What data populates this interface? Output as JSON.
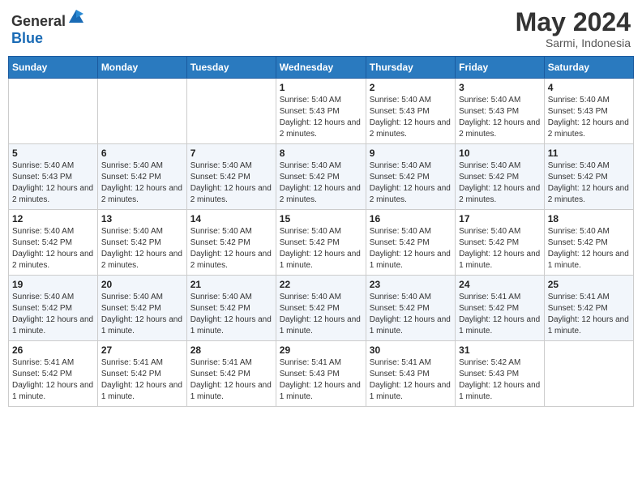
{
  "header": {
    "logo_general": "General",
    "logo_blue": "Blue",
    "month_title": "May 2024",
    "location": "Sarmi, Indonesia"
  },
  "weekdays": [
    "Sunday",
    "Monday",
    "Tuesday",
    "Wednesday",
    "Thursday",
    "Friday",
    "Saturday"
  ],
  "weeks": [
    [
      {
        "day": "",
        "sunrise": "",
        "sunset": "",
        "daylight": ""
      },
      {
        "day": "",
        "sunrise": "",
        "sunset": "",
        "daylight": ""
      },
      {
        "day": "",
        "sunrise": "",
        "sunset": "",
        "daylight": ""
      },
      {
        "day": "1",
        "sunrise": "Sunrise: 5:40 AM",
        "sunset": "Sunset: 5:43 PM",
        "daylight": "Daylight: 12 hours and 2 minutes."
      },
      {
        "day": "2",
        "sunrise": "Sunrise: 5:40 AM",
        "sunset": "Sunset: 5:43 PM",
        "daylight": "Daylight: 12 hours and 2 minutes."
      },
      {
        "day": "3",
        "sunrise": "Sunrise: 5:40 AM",
        "sunset": "Sunset: 5:43 PM",
        "daylight": "Daylight: 12 hours and 2 minutes."
      },
      {
        "day": "4",
        "sunrise": "Sunrise: 5:40 AM",
        "sunset": "Sunset: 5:43 PM",
        "daylight": "Daylight: 12 hours and 2 minutes."
      }
    ],
    [
      {
        "day": "5",
        "sunrise": "Sunrise: 5:40 AM",
        "sunset": "Sunset: 5:43 PM",
        "daylight": "Daylight: 12 hours and 2 minutes."
      },
      {
        "day": "6",
        "sunrise": "Sunrise: 5:40 AM",
        "sunset": "Sunset: 5:42 PM",
        "daylight": "Daylight: 12 hours and 2 minutes."
      },
      {
        "day": "7",
        "sunrise": "Sunrise: 5:40 AM",
        "sunset": "Sunset: 5:42 PM",
        "daylight": "Daylight: 12 hours and 2 minutes."
      },
      {
        "day": "8",
        "sunrise": "Sunrise: 5:40 AM",
        "sunset": "Sunset: 5:42 PM",
        "daylight": "Daylight: 12 hours and 2 minutes."
      },
      {
        "day": "9",
        "sunrise": "Sunrise: 5:40 AM",
        "sunset": "Sunset: 5:42 PM",
        "daylight": "Daylight: 12 hours and 2 minutes."
      },
      {
        "day": "10",
        "sunrise": "Sunrise: 5:40 AM",
        "sunset": "Sunset: 5:42 PM",
        "daylight": "Daylight: 12 hours and 2 minutes."
      },
      {
        "day": "11",
        "sunrise": "Sunrise: 5:40 AM",
        "sunset": "Sunset: 5:42 PM",
        "daylight": "Daylight: 12 hours and 2 minutes."
      }
    ],
    [
      {
        "day": "12",
        "sunrise": "Sunrise: 5:40 AM",
        "sunset": "Sunset: 5:42 PM",
        "daylight": "Daylight: 12 hours and 2 minutes."
      },
      {
        "day": "13",
        "sunrise": "Sunrise: 5:40 AM",
        "sunset": "Sunset: 5:42 PM",
        "daylight": "Daylight: 12 hours and 2 minutes."
      },
      {
        "day": "14",
        "sunrise": "Sunrise: 5:40 AM",
        "sunset": "Sunset: 5:42 PM",
        "daylight": "Daylight: 12 hours and 2 minutes."
      },
      {
        "day": "15",
        "sunrise": "Sunrise: 5:40 AM",
        "sunset": "Sunset: 5:42 PM",
        "daylight": "Daylight: 12 hours and 1 minute."
      },
      {
        "day": "16",
        "sunrise": "Sunrise: 5:40 AM",
        "sunset": "Sunset: 5:42 PM",
        "daylight": "Daylight: 12 hours and 1 minute."
      },
      {
        "day": "17",
        "sunrise": "Sunrise: 5:40 AM",
        "sunset": "Sunset: 5:42 PM",
        "daylight": "Daylight: 12 hours and 1 minute."
      },
      {
        "day": "18",
        "sunrise": "Sunrise: 5:40 AM",
        "sunset": "Sunset: 5:42 PM",
        "daylight": "Daylight: 12 hours and 1 minute."
      }
    ],
    [
      {
        "day": "19",
        "sunrise": "Sunrise: 5:40 AM",
        "sunset": "Sunset: 5:42 PM",
        "daylight": "Daylight: 12 hours and 1 minute."
      },
      {
        "day": "20",
        "sunrise": "Sunrise: 5:40 AM",
        "sunset": "Sunset: 5:42 PM",
        "daylight": "Daylight: 12 hours and 1 minute."
      },
      {
        "day": "21",
        "sunrise": "Sunrise: 5:40 AM",
        "sunset": "Sunset: 5:42 PM",
        "daylight": "Daylight: 12 hours and 1 minute."
      },
      {
        "day": "22",
        "sunrise": "Sunrise: 5:40 AM",
        "sunset": "Sunset: 5:42 PM",
        "daylight": "Daylight: 12 hours and 1 minute."
      },
      {
        "day": "23",
        "sunrise": "Sunrise: 5:40 AM",
        "sunset": "Sunset: 5:42 PM",
        "daylight": "Daylight: 12 hours and 1 minute."
      },
      {
        "day": "24",
        "sunrise": "Sunrise: 5:41 AM",
        "sunset": "Sunset: 5:42 PM",
        "daylight": "Daylight: 12 hours and 1 minute."
      },
      {
        "day": "25",
        "sunrise": "Sunrise: 5:41 AM",
        "sunset": "Sunset: 5:42 PM",
        "daylight": "Daylight: 12 hours and 1 minute."
      }
    ],
    [
      {
        "day": "26",
        "sunrise": "Sunrise: 5:41 AM",
        "sunset": "Sunset: 5:42 PM",
        "daylight": "Daylight: 12 hours and 1 minute."
      },
      {
        "day": "27",
        "sunrise": "Sunrise: 5:41 AM",
        "sunset": "Sunset: 5:42 PM",
        "daylight": "Daylight: 12 hours and 1 minute."
      },
      {
        "day": "28",
        "sunrise": "Sunrise: 5:41 AM",
        "sunset": "Sunset: 5:42 PM",
        "daylight": "Daylight: 12 hours and 1 minute."
      },
      {
        "day": "29",
        "sunrise": "Sunrise: 5:41 AM",
        "sunset": "Sunset: 5:43 PM",
        "daylight": "Daylight: 12 hours and 1 minute."
      },
      {
        "day": "30",
        "sunrise": "Sunrise: 5:41 AM",
        "sunset": "Sunset: 5:43 PM",
        "daylight": "Daylight: 12 hours and 1 minute."
      },
      {
        "day": "31",
        "sunrise": "Sunrise: 5:42 AM",
        "sunset": "Sunset: 5:43 PM",
        "daylight": "Daylight: 12 hours and 1 minute."
      },
      {
        "day": "",
        "sunrise": "",
        "sunset": "",
        "daylight": ""
      }
    ]
  ]
}
